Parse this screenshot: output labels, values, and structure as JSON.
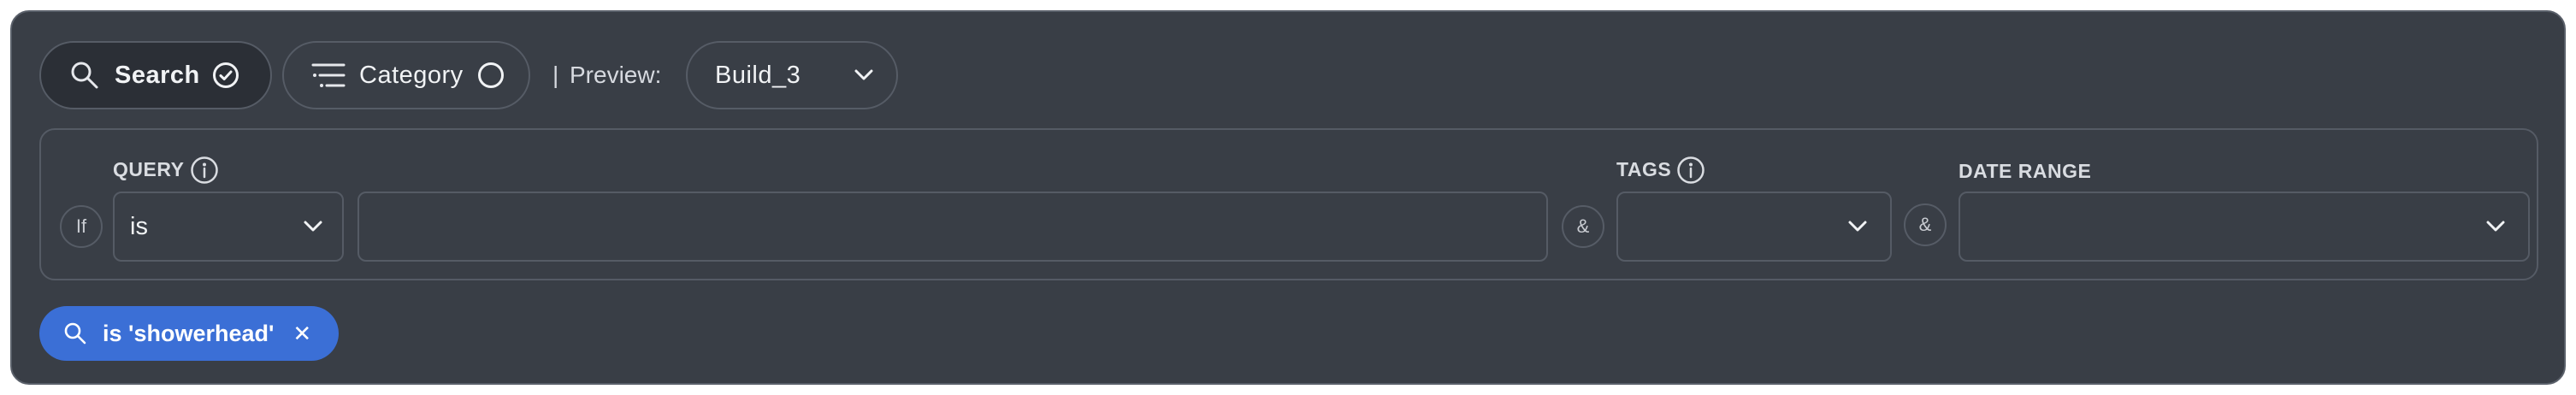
{
  "toolbar": {
    "search_label": "Search",
    "category_label": "Category",
    "separator": "|",
    "preview_label": "Preview:",
    "preview_value": "Build_3"
  },
  "builder": {
    "if_label": "If",
    "query": {
      "label": "QUERY",
      "operator": "is",
      "value": "",
      "placeholder": ""
    },
    "join_1": "&",
    "tags": {
      "label": "TAGS",
      "value": ""
    },
    "join_2": "&",
    "date_range": {
      "label": "DATE RANGE",
      "value": ""
    }
  },
  "active_filter": {
    "text": "is 'showerhead'",
    "remove_glyph": "✕"
  },
  "colors": {
    "panel": "#393e46",
    "chip": "#3b6fd6",
    "border": "#555b65"
  }
}
